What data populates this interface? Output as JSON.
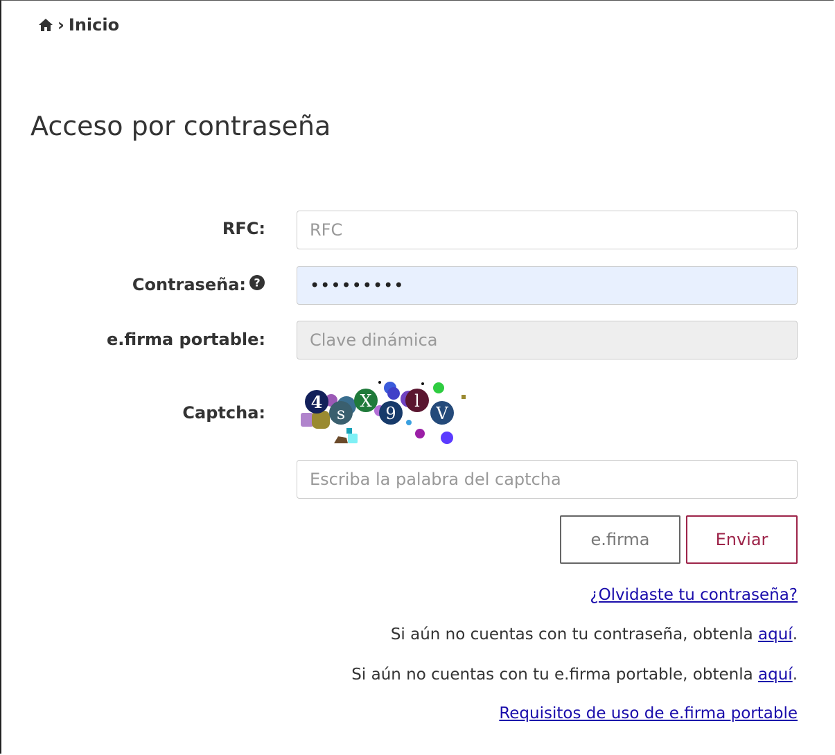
{
  "breadcrumb": {
    "home_icon": "home-icon",
    "separator": "›",
    "current": "Inicio"
  },
  "page": {
    "title": "Acceso por contraseña"
  },
  "form": {
    "rfc": {
      "label": "RFC:",
      "placeholder": "RFC",
      "value": ""
    },
    "password": {
      "label": "Contraseña:",
      "help_icon": "question-circle-icon",
      "value": "•••••••••"
    },
    "efirma_portable": {
      "label": "e.firma portable:",
      "placeholder": "Clave dinámica"
    },
    "captcha": {
      "label": "Captcha:",
      "text": "4sX9lV",
      "input_placeholder": "Escriba la palabra del captcha"
    }
  },
  "buttons": {
    "efirma": "e.firma",
    "enviar": "Enviar"
  },
  "links": {
    "forgot_password": "¿Olvidaste tu contraseña?",
    "no_password_text": "Si aún no cuentas con tu contraseña, obtenla ",
    "no_password_link": "aquí",
    "no_efirma_text": "Si aún no cuentas con tu e.firma portable, obtenla ",
    "no_efirma_link": "aquí",
    "period": ".",
    "requirements": "Requisitos de uso de e.firma portable"
  },
  "colors": {
    "accent": "#9d2449",
    "link": "#1a0dab",
    "autofill": "#e8f0fe"
  }
}
